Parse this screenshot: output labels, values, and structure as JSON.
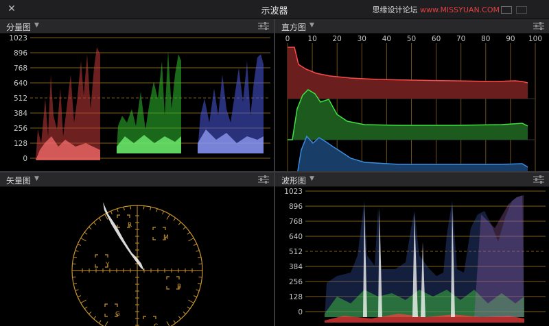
{
  "window": {
    "title": "示波器",
    "close_glyph": "✕",
    "watermark_a": "思缘设计论坛",
    "watermark_b": "www.MISSYUAN.COM"
  },
  "panels": {
    "parade": {
      "label": "分量图"
    },
    "histogram": {
      "label": "直方图"
    },
    "vectorscope": {
      "label": "矢量图"
    },
    "waveform": {
      "label": "波形图"
    }
  },
  "y_ticks": [
    "1023",
    "896",
    "768",
    "640",
    "512",
    "384",
    "256",
    "128",
    "0"
  ],
  "x_ticks": [
    "0",
    "10",
    "20",
    "30",
    "40",
    "50",
    "60",
    "70",
    "80",
    "90",
    "100"
  ],
  "vector_targets": [
    "R",
    "M",
    "B",
    "C",
    "G",
    "Y"
  ],
  "colors": {
    "accent": "#c8962e",
    "red": "#e05050",
    "green": "#3fd33f",
    "blue": "#5a6cf0"
  }
}
